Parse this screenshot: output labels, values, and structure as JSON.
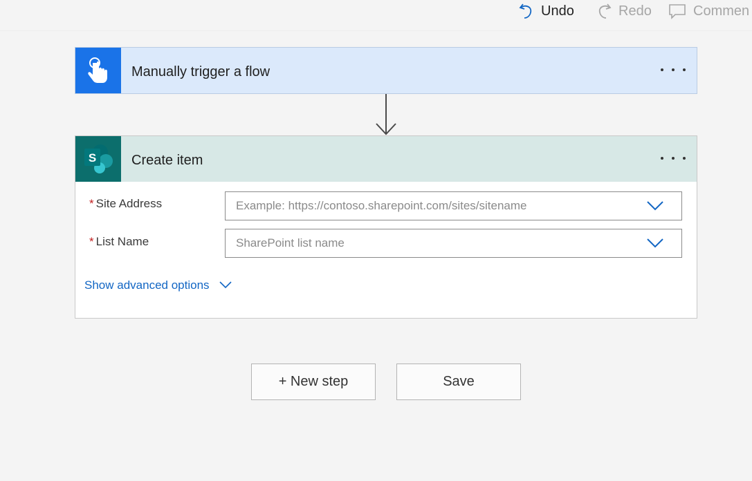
{
  "toolbar": {
    "undo_label": "Undo",
    "redo_label": "Redo",
    "comment_label": "Commen"
  },
  "trigger_card": {
    "title": "Manually trigger a flow",
    "icon": "hand-touch-icon",
    "color": "#1a73e8"
  },
  "action_card": {
    "title": "Create item",
    "icon": "sharepoint-icon",
    "icon_letter": "S",
    "color": "#0c6e6c",
    "fields": [
      {
        "label": "Site Address",
        "required": "*",
        "placeholder": "Example: https://contoso.sharepoint.com/sites/sitename",
        "value": ""
      },
      {
        "label": "List Name",
        "required": "*",
        "placeholder": "SharePoint list name",
        "value": ""
      }
    ],
    "advanced_label": "Show advanced options"
  },
  "footer": {
    "new_step_label": "+ New step",
    "save_label": "Save"
  },
  "colors": {
    "link": "#1266c4",
    "required": "#c21f1f"
  }
}
